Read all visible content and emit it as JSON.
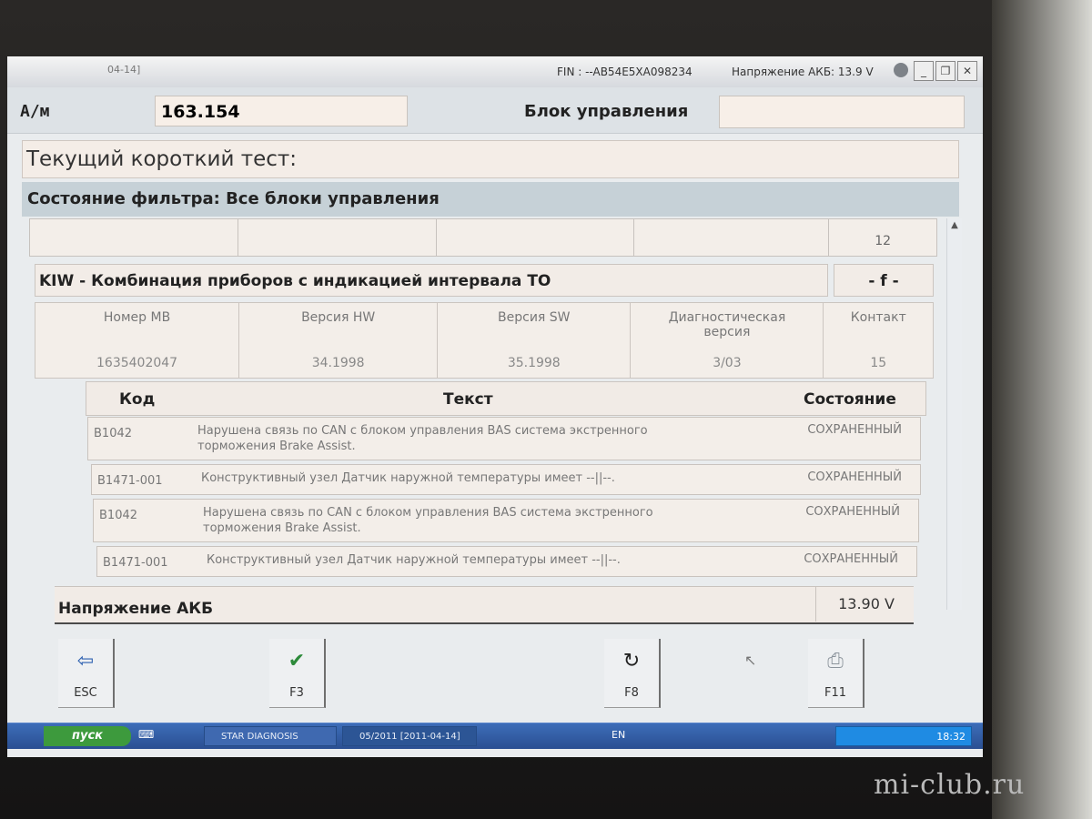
{
  "titlebar": {
    "left_text": "04-14]",
    "fin": "FIN : --AB54E5XA098234",
    "voltage": "Напряжение АКБ: 13.9 V",
    "min_label": "_",
    "restore_label": "❐",
    "close_label": "✕"
  },
  "header": {
    "am_label": "А/м",
    "am_value": "163.154",
    "control_unit_label": "Блок управления",
    "control_unit_value": ""
  },
  "current_test": "Текущий короткий тест:",
  "filter_state": "Состояние фильтра: Все блоки управления",
  "top_row_value": "12",
  "module": {
    "title": "KIW - Комбинация приборов с индикацией интервала ТО",
    "flag": "- f -",
    "columns": [
      {
        "header": "Номер MB",
        "value": "1635402047"
      },
      {
        "header": "Версия HW",
        "value": "34.1998"
      },
      {
        "header": "Версия SW",
        "value": "35.1998"
      },
      {
        "header": "Диагностическая версия",
        "value": "3/03"
      },
      {
        "header": "Контакт",
        "value": "15"
      }
    ]
  },
  "error_table": {
    "headers": {
      "code": "Код",
      "text": "Текст",
      "state": "Состояние"
    },
    "rows": [
      {
        "code": "B1042",
        "text": "Нарушена связь по CAN с блоком управления BAS система экстренного торможения Brake Assist.",
        "state": "СОХРАНЕННЫЙ"
      },
      {
        "code": "B1471-001",
        "text": "Конструктивный узел Датчик наружной температуры имеет --||--.",
        "state": "СОХРАНЕННЫЙ"
      },
      {
        "code": "B1042",
        "text": "Нарушена связь по CAN с блоком управления BAS система экстренного торможения Brake Assist.",
        "state": "СОХРАНЕННЫЙ"
      },
      {
        "code": "B1471-001",
        "text": "Конструктивный узел Датчик наружной температуры имеет --||--.",
        "state": "СОХРАНЕННЫЙ"
      }
    ]
  },
  "battery": {
    "label": "Напряжение АКБ",
    "value": "13.90 V"
  },
  "fkeys": {
    "esc": "ESC",
    "f3": "F3",
    "f8": "F8",
    "f11": "F11"
  },
  "taskbar": {
    "start": "пуск",
    "task1": "STAR DIAGNOSIS",
    "task2": "05/2011 [2011-04-14]",
    "lang": "EN",
    "tray_time": "18:32"
  },
  "watermark": "mi-club.ru"
}
